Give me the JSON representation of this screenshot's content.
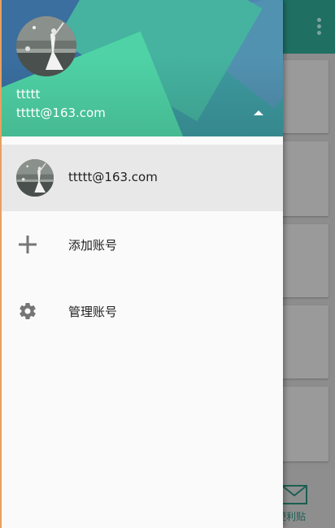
{
  "background": {
    "bottom_nav_label": "便利贴",
    "icons": [
      "more-vert-icon",
      "mail-icon"
    ]
  },
  "drawer": {
    "header": {
      "name": "ttttt",
      "email": "ttttt@163.com",
      "toggle_icon": "arrow-up-icon"
    },
    "current_account": {
      "email": "ttttt@163.com"
    },
    "menu": [
      {
        "label": "添加账号",
        "icon": "add-icon"
      },
      {
        "label": "管理账号",
        "icon": "settings-gear-icon"
      }
    ]
  },
  "colors": {
    "appbar": "#1f6f62",
    "header_teal": "#45b3a0",
    "header_mint": "#4fd3a6",
    "header_blue": "#3a6fa0",
    "selected_row": "#e8e8e8",
    "icon_gray": "#757575"
  }
}
